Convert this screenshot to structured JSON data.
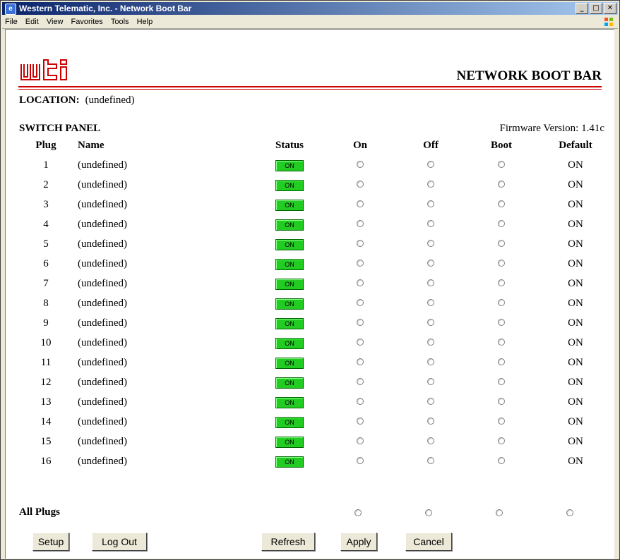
{
  "window": {
    "title": "Western Telematic, Inc. - Network Boot Bar"
  },
  "menu": [
    "File",
    "Edit",
    "View",
    "Favorites",
    "Tools",
    "Help"
  ],
  "header": {
    "logo_text": "wti",
    "page_title": "NETWORK BOOT BAR"
  },
  "location": {
    "label": "LOCATION:",
    "value": "(undefined)"
  },
  "panel": {
    "title": "SWITCH PANEL",
    "firmware": "Firmware Version: 1.41c"
  },
  "columns": {
    "plug": "Plug",
    "name": "Name",
    "status": "Status",
    "on": "On",
    "off": "Off",
    "boot": "Boot",
    "default": "Default"
  },
  "rows": [
    {
      "plug": "1",
      "name": "(undefined)",
      "status": "ON",
      "default": "ON"
    },
    {
      "plug": "2",
      "name": "(undefined)",
      "status": "ON",
      "default": "ON"
    },
    {
      "plug": "3",
      "name": "(undefined)",
      "status": "ON",
      "default": "ON"
    },
    {
      "plug": "4",
      "name": "(undefined)",
      "status": "ON",
      "default": "ON"
    },
    {
      "plug": "5",
      "name": "(undefined)",
      "status": "ON",
      "default": "ON"
    },
    {
      "plug": "6",
      "name": "(undefined)",
      "status": "ON",
      "default": "ON"
    },
    {
      "plug": "7",
      "name": "(undefined)",
      "status": "ON",
      "default": "ON"
    },
    {
      "plug": "8",
      "name": "(undefined)",
      "status": "ON",
      "default": "ON"
    },
    {
      "plug": "9",
      "name": "(undefined)",
      "status": "ON",
      "default": "ON"
    },
    {
      "plug": "10",
      "name": "(undefined)",
      "status": "ON",
      "default": "ON"
    },
    {
      "plug": "11",
      "name": "(undefined)",
      "status": "ON",
      "default": "ON"
    },
    {
      "plug": "12",
      "name": "(undefined)",
      "status": "ON",
      "default": "ON"
    },
    {
      "plug": "13",
      "name": "(undefined)",
      "status": "ON",
      "default": "ON"
    },
    {
      "plug": "14",
      "name": "(undefined)",
      "status": "ON",
      "default": "ON"
    },
    {
      "plug": "15",
      "name": "(undefined)",
      "status": "ON",
      "default": "ON"
    },
    {
      "plug": "16",
      "name": "(undefined)",
      "status": "ON",
      "default": "ON"
    }
  ],
  "all_plugs": {
    "label": "All Plugs"
  },
  "buttons": {
    "setup": "Setup",
    "logout": "Log Out",
    "refresh": "Refresh",
    "apply": "Apply",
    "cancel": "Cancel"
  },
  "colors": {
    "accent_red": "#cc0000",
    "status_green": "#22cc22"
  }
}
